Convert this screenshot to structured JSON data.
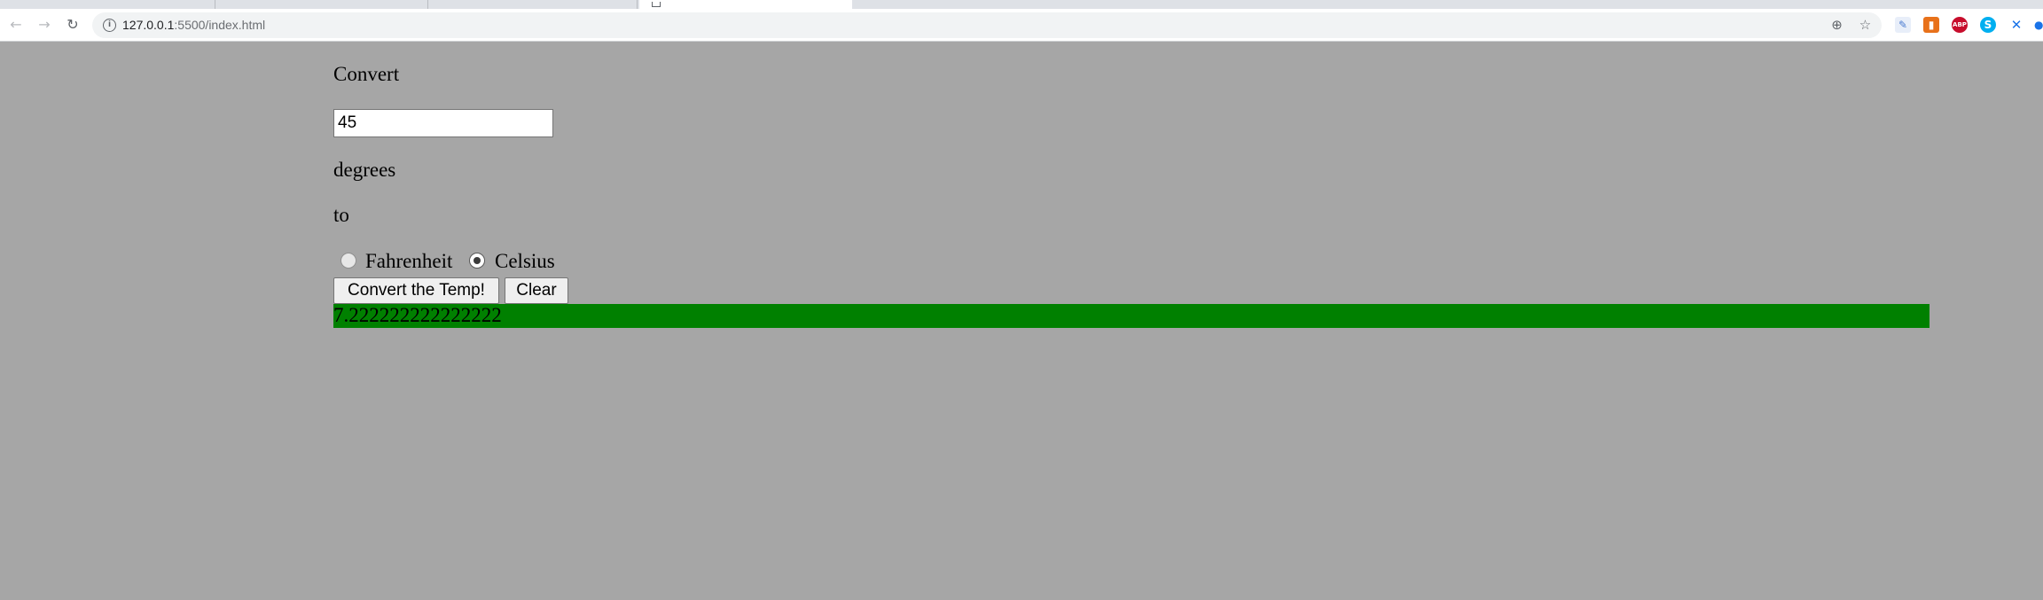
{
  "browser": {
    "url_host": "127.0.0.1",
    "url_path": ":5500/index.html",
    "icons": {
      "back": "back-arrow-icon",
      "forward": "forward-arrow-icon",
      "reload": "reload-icon",
      "info": "info-icon",
      "zoom": "zoom-icon",
      "bookmark": "star-icon"
    },
    "extensions": [
      {
        "name": "notes-extension-icon",
        "glyph": "✎",
        "color": "#8ab4f8"
      },
      {
        "name": "office-extension-icon",
        "glyph": "▮",
        "color": "#e8711a"
      },
      {
        "name": "adblock-plus-icon",
        "glyph": "ABP",
        "color": "#c70d2c"
      },
      {
        "name": "skype-icon",
        "glyph": "S",
        "color": "#00aff0"
      },
      {
        "name": "tools-extension-icon",
        "glyph": "✕",
        "color": "#1a73e8"
      }
    ]
  },
  "form": {
    "convert_label": "Convert",
    "temperature_value": "45",
    "degrees_label": "degrees",
    "to_label": "to",
    "unit_options": [
      {
        "label": "Fahrenheit",
        "selected": false
      },
      {
        "label": "Celsius",
        "selected": true
      }
    ],
    "convert_button": "Convert the Temp!",
    "clear_button": "Clear",
    "result": "7.222222222222222",
    "result_color": "#008000",
    "background_color": "#a6a6a6"
  }
}
